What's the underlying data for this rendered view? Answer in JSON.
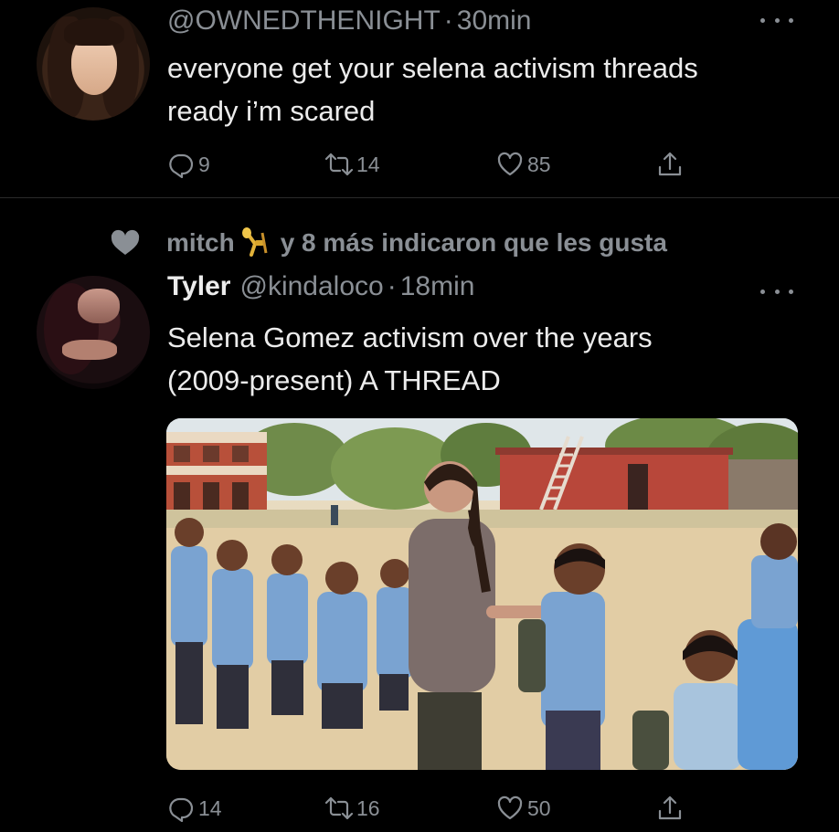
{
  "tweet1": {
    "handle": "@OWNEDTHENIGHT",
    "separator": "·",
    "time": "30min",
    "text_line1": "everyone get your selena activism threads",
    "text_line2": "ready i’m scared",
    "replies": "9",
    "retweets": "14",
    "likes": "85"
  },
  "tweet2": {
    "context_user": "mitch",
    "context_text": "y 8 más indicaron que les gusta",
    "name": "Tyler",
    "handle": "@kindaloco",
    "separator": "·",
    "time": "18min",
    "text_line1": "Selena Gomez activism over the years",
    "text_line2": "(2009-present) A THREAD",
    "replies": "14",
    "retweets": "16",
    "likes": "50"
  },
  "icons": {
    "reply": "reply-icon",
    "retweet": "retweet-icon",
    "like": "heart-icon",
    "share": "share-icon",
    "more": "more-icon"
  },
  "colors": {
    "background": "#000000",
    "text": "#ececec",
    "muted": "#8a8f95",
    "divider": "#2a2a2a"
  }
}
